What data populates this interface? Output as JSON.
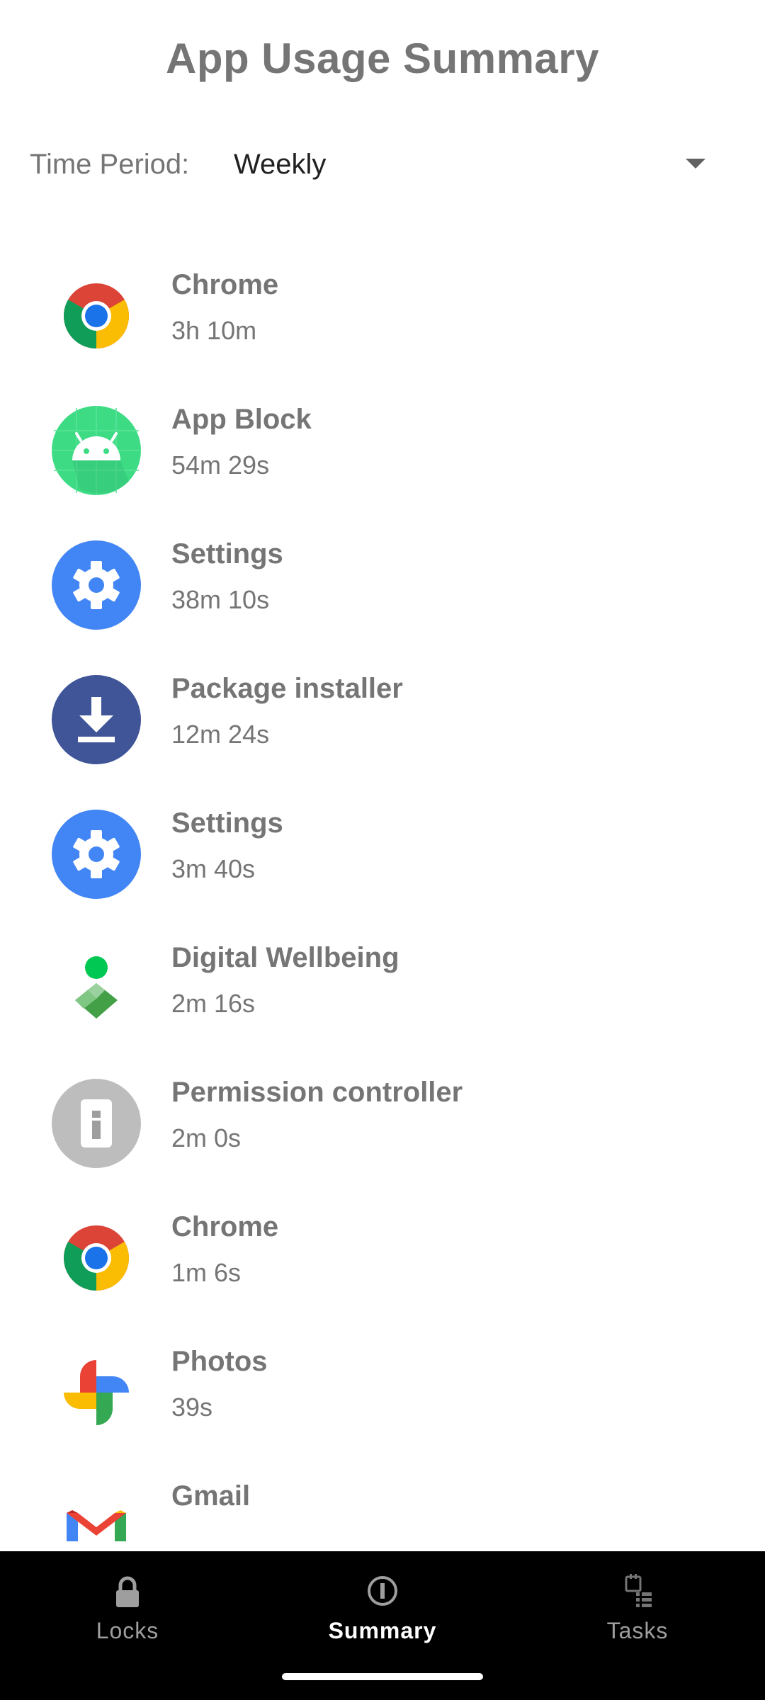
{
  "header": {
    "title": "App Usage Summary"
  },
  "period": {
    "label": "Time Period:",
    "selected": "Weekly"
  },
  "apps": [
    {
      "name": "Chrome",
      "time": "3h 10m",
      "icon": "chrome-icon"
    },
    {
      "name": "App Block",
      "time": "54m 29s",
      "icon": "android-icon"
    },
    {
      "name": "Settings",
      "time": "38m 10s",
      "icon": "gear-icon"
    },
    {
      "name": "Package installer",
      "time": "12m 24s",
      "icon": "download-icon"
    },
    {
      "name": "Settings",
      "time": "3m 40s",
      "icon": "gear-icon"
    },
    {
      "name": "Digital Wellbeing",
      "time": "2m 16s",
      "icon": "wellbeing-icon"
    },
    {
      "name": "Permission controller",
      "time": "2m 0s",
      "icon": "permission-icon"
    },
    {
      "name": "Chrome",
      "time": "1m 6s",
      "icon": "chrome-icon"
    },
    {
      "name": "Photos",
      "time": "39s",
      "icon": "photos-icon"
    },
    {
      "name": "Gmail",
      "time": "",
      "icon": "gmail-icon"
    }
  ],
  "nav": {
    "items": [
      {
        "label": "Locks",
        "icon": "lock-icon",
        "active": false
      },
      {
        "label": "Summary",
        "icon": "summary-icon",
        "active": true
      },
      {
        "label": "Tasks",
        "icon": "tasks-icon",
        "active": false
      }
    ]
  },
  "colors": {
    "text_gray": "#757575",
    "nav_bg": "#000000",
    "nav_active": "#ffffff",
    "nav_inactive": "#9e9e9e",
    "settings_blue": "#4285f4",
    "installer_navy": "#3f5597"
  }
}
